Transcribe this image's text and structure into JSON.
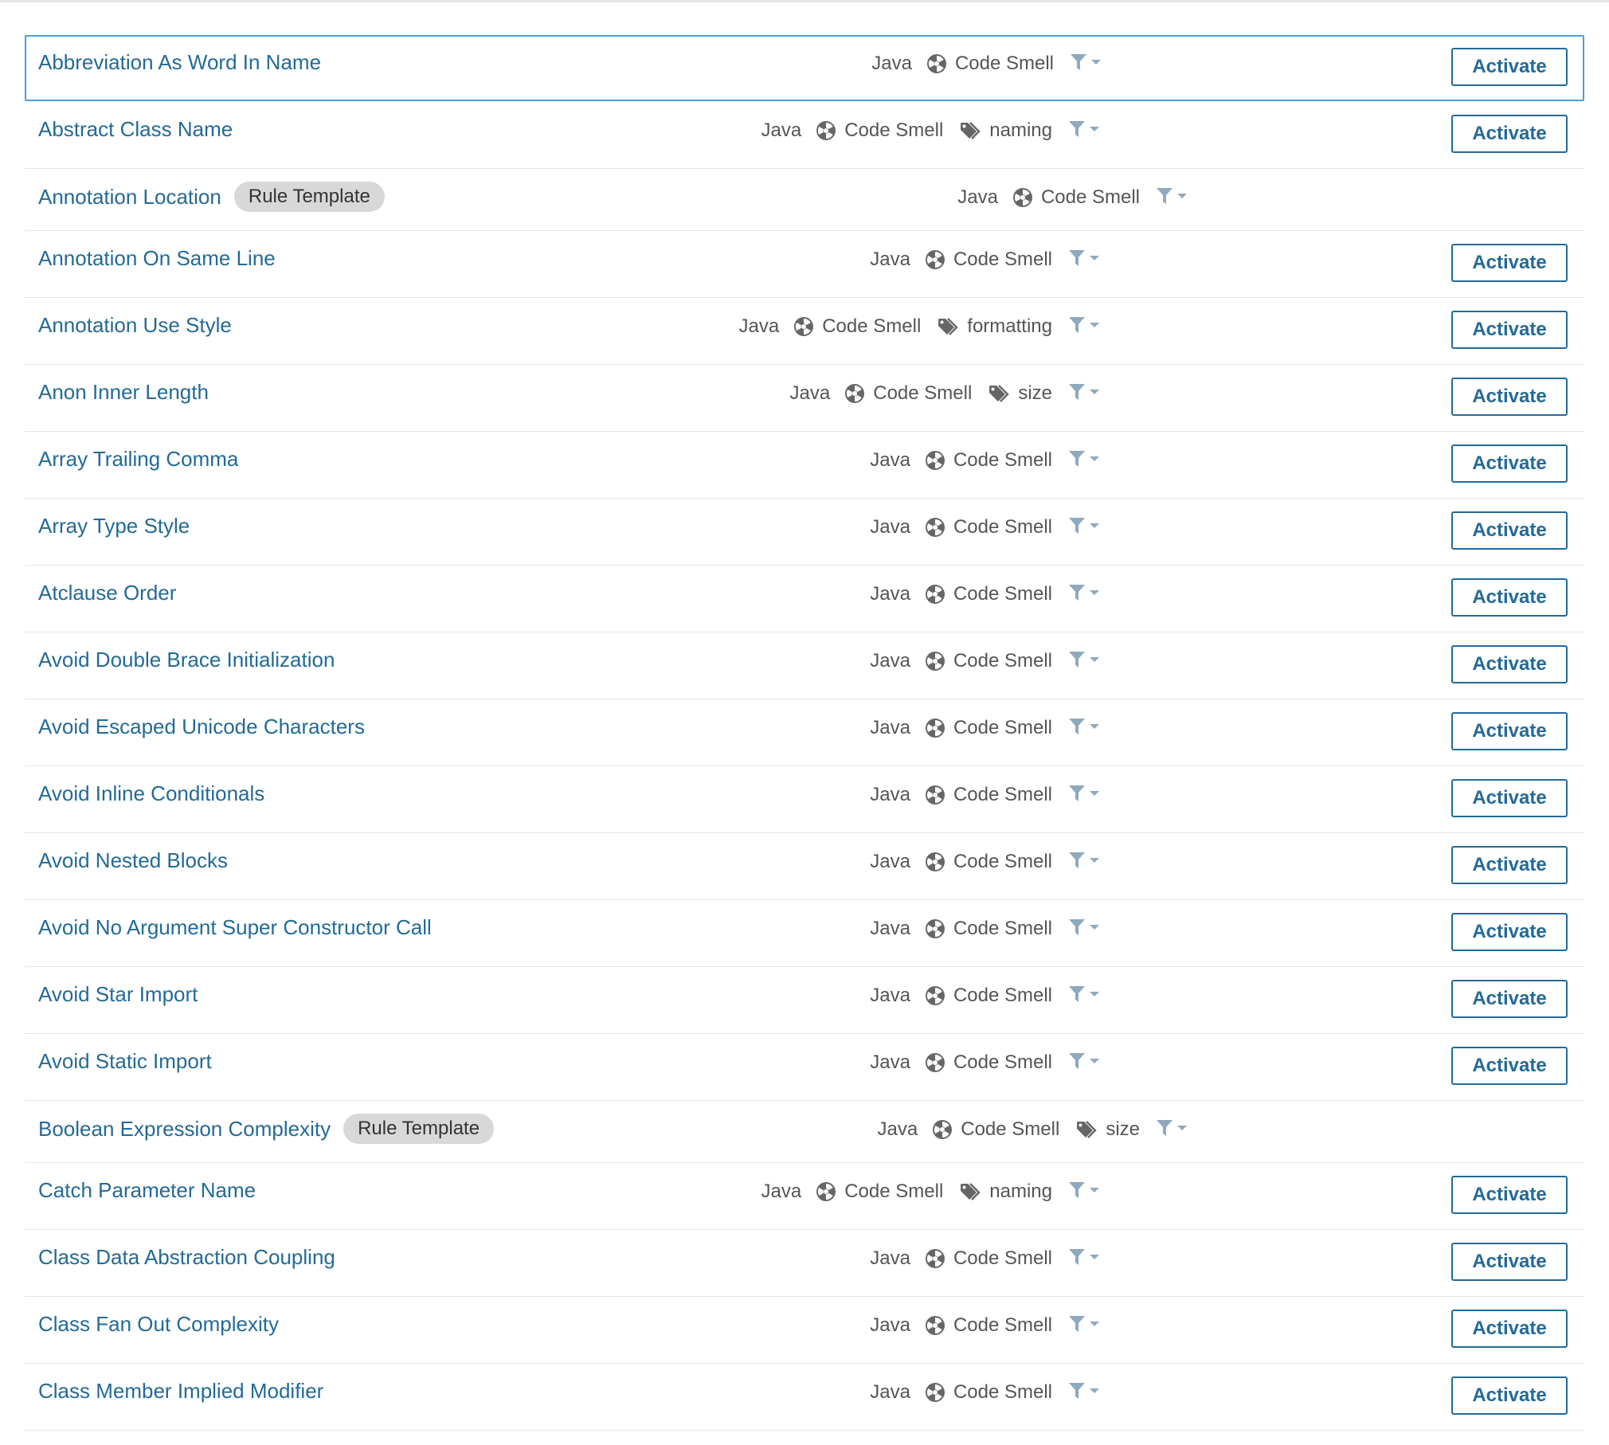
{
  "rules": [
    {
      "title": "Abbreviation As Word In Name",
      "badge": "",
      "language": "Java",
      "type": "Code Smell",
      "tag": "",
      "action": "Activate",
      "selected": true
    },
    {
      "title": "Abstract Class Name",
      "badge": "",
      "language": "Java",
      "type": "Code Smell",
      "tag": "naming",
      "action": "Activate"
    },
    {
      "title": "Annotation Location",
      "badge": "Rule Template",
      "language": "Java",
      "type": "Code Smell",
      "tag": "",
      "action": ""
    },
    {
      "title": "Annotation On Same Line",
      "badge": "",
      "language": "Java",
      "type": "Code Smell",
      "tag": "",
      "action": "Activate"
    },
    {
      "title": "Annotation Use Style",
      "badge": "",
      "language": "Java",
      "type": "Code Smell",
      "tag": "formatting",
      "action": "Activate"
    },
    {
      "title": "Anon Inner Length",
      "badge": "",
      "language": "Java",
      "type": "Code Smell",
      "tag": "size",
      "action": "Activate"
    },
    {
      "title": "Array Trailing Comma",
      "badge": "",
      "language": "Java",
      "type": "Code Smell",
      "tag": "",
      "action": "Activate"
    },
    {
      "title": "Array Type Style",
      "badge": "",
      "language": "Java",
      "type": "Code Smell",
      "tag": "",
      "action": "Activate"
    },
    {
      "title": "Atclause Order",
      "badge": "",
      "language": "Java",
      "type": "Code Smell",
      "tag": "",
      "action": "Activate"
    },
    {
      "title": "Avoid Double Brace Initialization",
      "badge": "",
      "language": "Java",
      "type": "Code Smell",
      "tag": "",
      "action": "Activate"
    },
    {
      "title": "Avoid Escaped Unicode Characters",
      "badge": "",
      "language": "Java",
      "type": "Code Smell",
      "tag": "",
      "action": "Activate"
    },
    {
      "title": "Avoid Inline Conditionals",
      "badge": "",
      "language": "Java",
      "type": "Code Smell",
      "tag": "",
      "action": "Activate"
    },
    {
      "title": "Avoid Nested Blocks",
      "badge": "",
      "language": "Java",
      "type": "Code Smell",
      "tag": "",
      "action": "Activate"
    },
    {
      "title": "Avoid No Argument Super Constructor Call",
      "badge": "",
      "language": "Java",
      "type": "Code Smell",
      "tag": "",
      "action": "Activate"
    },
    {
      "title": "Avoid Star Import",
      "badge": "",
      "language": "Java",
      "type": "Code Smell",
      "tag": "",
      "action": "Activate"
    },
    {
      "title": "Avoid Static Import",
      "badge": "",
      "language": "Java",
      "type": "Code Smell",
      "tag": "",
      "action": "Activate"
    },
    {
      "title": "Boolean Expression Complexity",
      "badge": "Rule Template",
      "language": "Java",
      "type": "Code Smell",
      "tag": "size",
      "action": ""
    },
    {
      "title": "Catch Parameter Name",
      "badge": "",
      "language": "Java",
      "type": "Code Smell",
      "tag": "naming",
      "action": "Activate"
    },
    {
      "title": "Class Data Abstraction Coupling",
      "badge": "",
      "language": "Java",
      "type": "Code Smell",
      "tag": "",
      "action": "Activate"
    },
    {
      "title": "Class Fan Out Complexity",
      "badge": "",
      "language": "Java",
      "type": "Code Smell",
      "tag": "",
      "action": "Activate"
    },
    {
      "title": "Class Member Implied Modifier",
      "badge": "",
      "language": "Java",
      "type": "Code Smell",
      "tag": "",
      "action": "Activate"
    }
  ],
  "icons": {
    "type": "code-smell-icon",
    "tag": "tag-icon",
    "filter": "filter-icon",
    "dropdown": "chevron-down-icon"
  },
  "colors": {
    "link": "#236a97",
    "meta_text": "#555555",
    "icon_gray": "#666666",
    "filter_blue": "#8fa9be",
    "badge_bg": "#d8d8d8",
    "selected_border": "#4b9fd5",
    "divider": "#e6e6e6"
  }
}
